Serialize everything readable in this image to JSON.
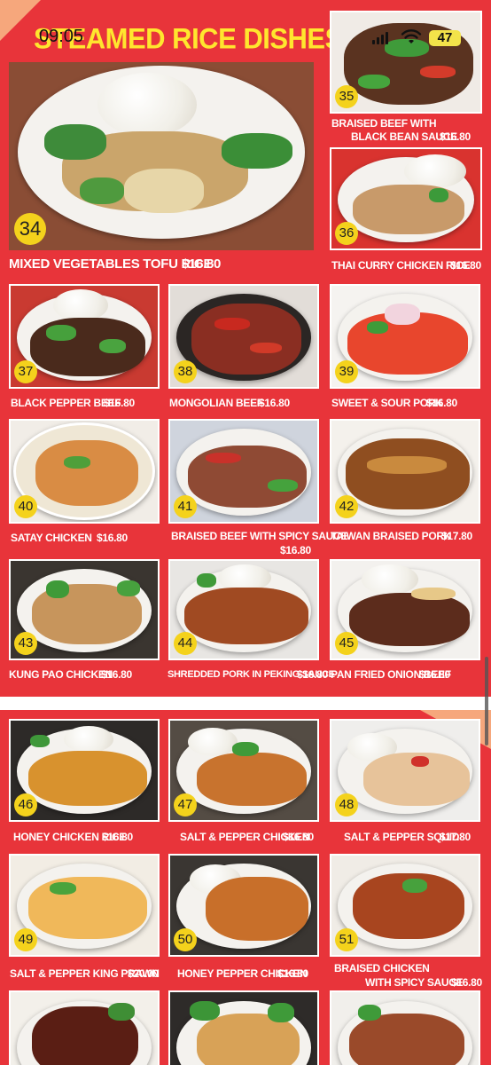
{
  "status_bar": {
    "time": "09:05",
    "battery": "47"
  },
  "menu": {
    "title": "STEAMED RICE DISHES"
  },
  "colors": {
    "background": "#e8343a",
    "title": "#ffe62e",
    "badge": "#f4d21c",
    "accent_corner": "#f6a77c"
  },
  "dishes": [
    {
      "num": "34",
      "name": "MIXED VEGETABLES TOFU RICE",
      "price": "$16.80"
    },
    {
      "num": "35",
      "name": "BRAISED BEEF WITH",
      "name2": "BLACK BEAN SAUCE",
      "price": "$16.80"
    },
    {
      "num": "36",
      "name": "THAI CURRY CHICKEN RICE",
      "price": "$16.80"
    },
    {
      "num": "37",
      "name": "BLACK PEPPER BEEF",
      "price": "$16.80"
    },
    {
      "num": "38",
      "name": "MONGOLIAN BEEF",
      "price": "$16.80"
    },
    {
      "num": "39",
      "name": "SWEET & SOUR PORK",
      "price": "$16.80"
    },
    {
      "num": "40",
      "name": "SATAY CHICKEN",
      "price": "$16.80"
    },
    {
      "num": "41",
      "name": "BRAISED BEEF WITH  SPICY SAUCE",
      "price": "$16.80"
    },
    {
      "num": "42",
      "name": "TAIWAN  BRAISED PORK",
      "price": "$17.80"
    },
    {
      "num": "43",
      "name": "KUNG PAO CHICKEN",
      "price": "$16.80"
    },
    {
      "num": "44",
      "name": "SHREDDED PORK IN PEKING SAUCE",
      "price": "$16.80"
    },
    {
      "num": "45",
      "name": "PAN FRIED ONION BEEF",
      "price": "$16.80"
    },
    {
      "num": "46",
      "name": "HONEY CHICKEN RICE",
      "price": "$16.80"
    },
    {
      "num": "47",
      "name": "SALT & PEPPER CHICKEN",
      "price": "$16.80"
    },
    {
      "num": "48",
      "name": "SALT & PEPPER SQUID",
      "price": "$17.80"
    },
    {
      "num": "49",
      "name": "SALT & PEPPER KING PRAWN",
      "price": "$20.00"
    },
    {
      "num": "50",
      "name": "HONEY PEPPER CHICKEN",
      "price": "$16.80"
    },
    {
      "num": "51",
      "name": "BRAISED CHICKEN",
      "name2": "WITH SPICY SAUCE",
      "price": "$16.80"
    }
  ]
}
